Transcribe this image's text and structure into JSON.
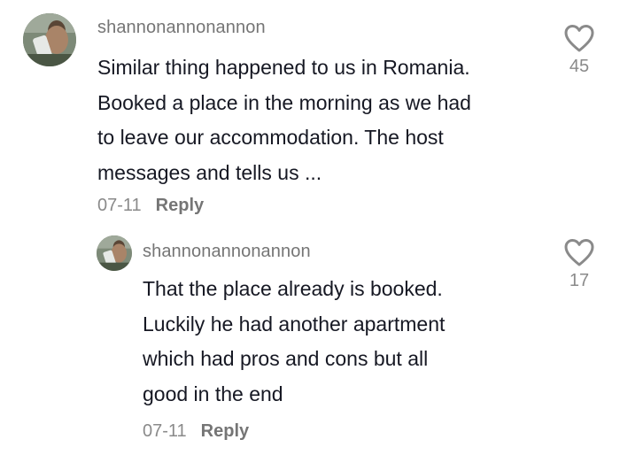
{
  "comments": [
    {
      "username": "shannonannonannon",
      "lines": [
        "Similar thing happened to us in Romania.",
        "Booked a place in the morning as we had",
        "to leave our accommodation. The host",
        "messages and tells us ..."
      ],
      "date": "07-11",
      "reply_label": "Reply",
      "likes": "45"
    },
    {
      "username": "shannonannonannon",
      "lines": [
        "That the place already is booked.",
        "Luckily he had another apartment",
        "which had pros and cons but all",
        "good in the end"
      ],
      "date": "07-11",
      "reply_label": "Reply",
      "likes": "17"
    }
  ],
  "icons": {
    "like": "heart-outline-icon"
  },
  "colors": {
    "text": "#161823",
    "muted": "#8a8a8a",
    "username": "#757575"
  }
}
